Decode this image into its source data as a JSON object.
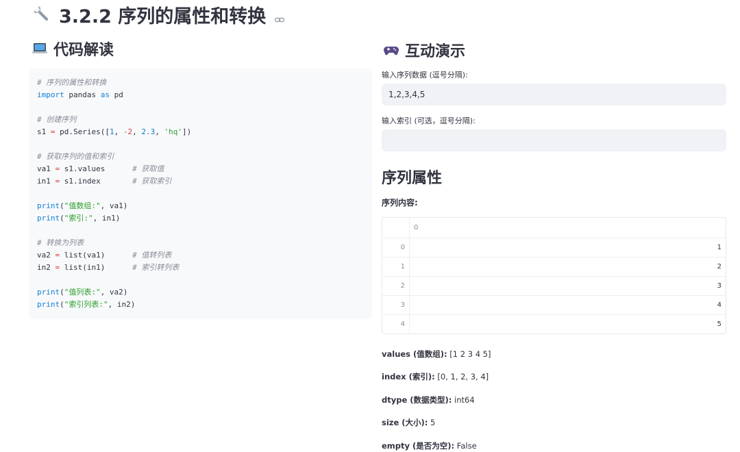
{
  "page": {
    "title": "3.2.2 序列的属性和转换",
    "icons": {
      "title": "wrench-icon",
      "link": "link-icon",
      "code_section": "laptop-icon",
      "demo_section": "game-controller-icon"
    }
  },
  "code_section": {
    "heading": "代码解读",
    "lines": [
      [
        {
          "t": "# 序列的属性和转换",
          "c": "c-com"
        }
      ],
      [
        {
          "t": "import",
          "c": "c-kw"
        },
        {
          "t": " pandas "
        },
        {
          "t": "as",
          "c": "c-kw"
        },
        {
          "t": " pd"
        }
      ],
      [],
      [
        {
          "t": "# 创建序列",
          "c": "c-com"
        }
      ],
      [
        {
          "t": "s1 "
        },
        {
          "t": "=",
          "c": "c-op"
        },
        {
          "t": " pd.Series(["
        },
        {
          "t": "1",
          "c": "c-num"
        },
        {
          "t": ", "
        },
        {
          "t": "-2",
          "c": "c-op"
        },
        {
          "t": ", "
        },
        {
          "t": "2.3",
          "c": "c-num"
        },
        {
          "t": ", "
        },
        {
          "t": "'hq'",
          "c": "c-str"
        },
        {
          "t": "])"
        }
      ],
      [],
      [
        {
          "t": "# 获取序列的值和索引",
          "c": "c-com"
        }
      ],
      [
        {
          "t": "va1 "
        },
        {
          "t": "=",
          "c": "c-op"
        },
        {
          "t": " s1.values      "
        },
        {
          "t": "# 获取值",
          "c": "c-com"
        }
      ],
      [
        {
          "t": "in1 "
        },
        {
          "t": "=",
          "c": "c-op"
        },
        {
          "t": " s1.index       "
        },
        {
          "t": "# 获取索引",
          "c": "c-com"
        }
      ],
      [],
      [
        {
          "t": "print",
          "c": "c-kw"
        },
        {
          "t": "("
        },
        {
          "t": "\"值数组:\"",
          "c": "c-str"
        },
        {
          "t": ", va1)"
        }
      ],
      [
        {
          "t": "print",
          "c": "c-kw"
        },
        {
          "t": "("
        },
        {
          "t": "\"索引:\"",
          "c": "c-str"
        },
        {
          "t": ", in1)"
        }
      ],
      [],
      [
        {
          "t": "# 转换为列表",
          "c": "c-com"
        }
      ],
      [
        {
          "t": "va2 "
        },
        {
          "t": "=",
          "c": "c-op"
        },
        {
          "t": " list(va1)      "
        },
        {
          "t": "# 值转列表",
          "c": "c-com"
        }
      ],
      [
        {
          "t": "in2 "
        },
        {
          "t": "=",
          "c": "c-op"
        },
        {
          "t": " list(in1)      "
        },
        {
          "t": "# 索引转列表",
          "c": "c-com"
        }
      ],
      [],
      [
        {
          "t": "print",
          "c": "c-kw"
        },
        {
          "t": "("
        },
        {
          "t": "\"值列表:\"",
          "c": "c-str"
        },
        {
          "t": ", va2)"
        }
      ],
      [
        {
          "t": "print",
          "c": "c-kw"
        },
        {
          "t": "("
        },
        {
          "t": "\"索引列表:\"",
          "c": "c-str"
        },
        {
          "t": ", in2)"
        }
      ]
    ]
  },
  "demo": {
    "heading": "互动演示",
    "series_input": {
      "label": "输入序列数据 (逗号分隔):",
      "value": "1,2,3,4,5"
    },
    "index_input": {
      "label": "输入索引 (可选，逗号分隔):",
      "value": ""
    },
    "props_heading": "序列属性",
    "content_label": "序列内容:",
    "table": {
      "column": "0",
      "rows": [
        {
          "index": "0",
          "value": "1"
        },
        {
          "index": "1",
          "value": "2"
        },
        {
          "index": "2",
          "value": "3"
        },
        {
          "index": "3",
          "value": "4"
        },
        {
          "index": "4",
          "value": "5"
        }
      ]
    },
    "properties": [
      {
        "key": "values (值数组):",
        "value": " [1 2 3 4 5]"
      },
      {
        "key": "index (索引):",
        "value": " [0, 1, 2, 3, 4]"
      },
      {
        "key": "dtype (数据类型):",
        "value": " int64"
      },
      {
        "key": "size (大小):",
        "value": " 5"
      },
      {
        "key": "empty (是否为空):",
        "value": " False"
      }
    ]
  },
  "colors": {
    "accent_blue": "#0f7fd6",
    "string_green": "#2ca02c",
    "operator_red": "#d53b3b",
    "comment_gray": "#8a8d97",
    "input_bg": "#f0f2f6",
    "code_bg": "#f8f9fb"
  }
}
